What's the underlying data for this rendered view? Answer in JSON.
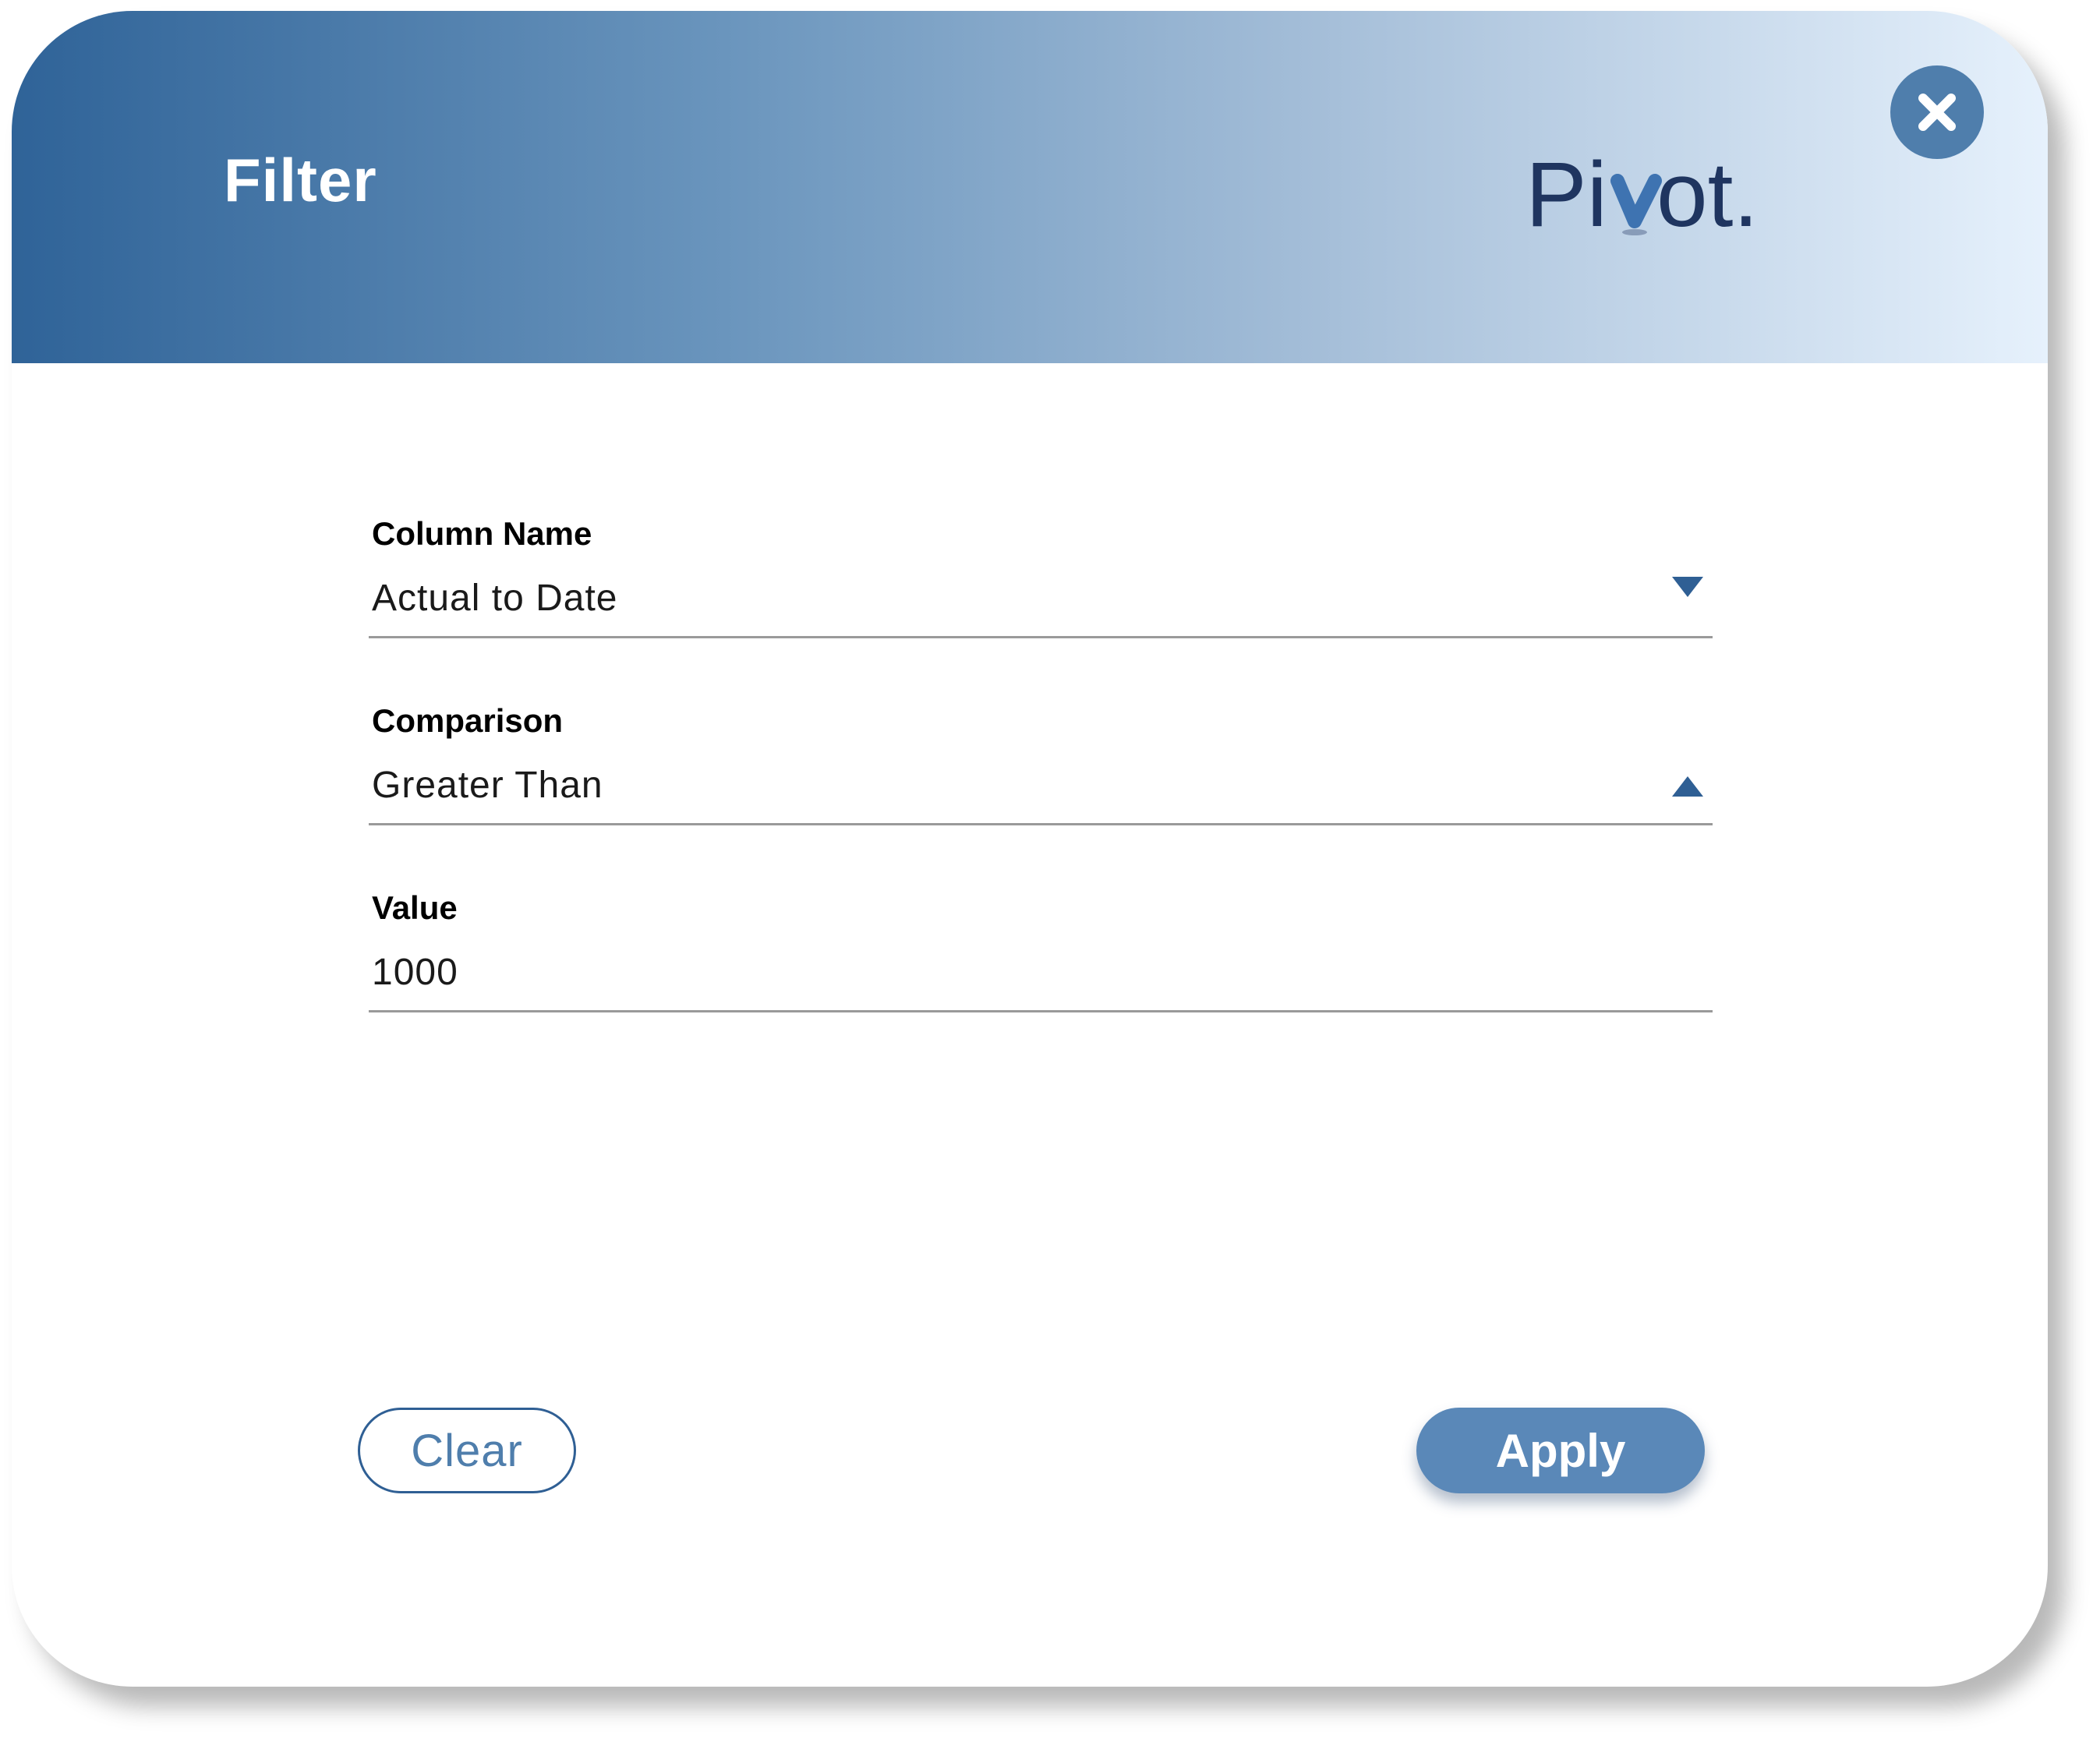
{
  "dialog": {
    "title": "Filter",
    "logo_text": {
      "part1": "Pi",
      "part2": "ot."
    },
    "close_icon": "close-icon"
  },
  "fields": {
    "column_name": {
      "label": "Column Name",
      "value": "Actual to Date",
      "caret_icon": "caret-down-icon"
    },
    "comparison": {
      "label": "Comparison",
      "value": "Greater Than",
      "caret_icon": "caret-up-icon"
    },
    "value": {
      "label": "Value",
      "value": "1000"
    }
  },
  "buttons": {
    "clear_label": "Clear",
    "apply_label": "Apply"
  },
  "colors": {
    "header_start": "#2f6398",
    "header_end": "#e6f1fc",
    "accent": "#2f5f94",
    "apply_bg": "#5a88b8",
    "close_bg": "#4f7eac",
    "logo_text": "#1f3560"
  }
}
